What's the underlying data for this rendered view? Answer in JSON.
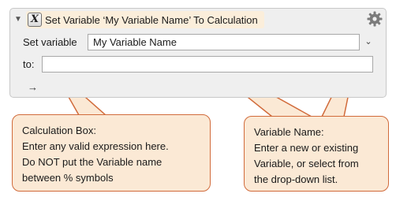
{
  "action": {
    "title": "Set Variable ‘My Variable Name’ To Calculation",
    "action_icon": "x-calculation-icon",
    "gear_icon": "gear-icon",
    "disclosure_icon": "disclosure-triangle-down-icon"
  },
  "form": {
    "set_variable_label": "Set variable",
    "variable_value": "My Variable Name",
    "to_label": "to:",
    "calculation_value": "",
    "arrow_glyph": "→"
  },
  "callouts": {
    "calc": {
      "lines": [
        "Calculation Box:",
        "Enter any valid expression here.",
        "Do NOT put the Variable name",
        "between % symbols"
      ]
    },
    "var": {
      "lines": [
        "Variable Name:",
        "Enter a new or existing",
        "Variable, or select from",
        "the drop-down list."
      ]
    }
  },
  "colors": {
    "callout_fill": "#fbe9d5",
    "callout_border": "#d16b3b",
    "title_bar_fill": "#fbeedb",
    "panel_fill": "#efefef"
  }
}
